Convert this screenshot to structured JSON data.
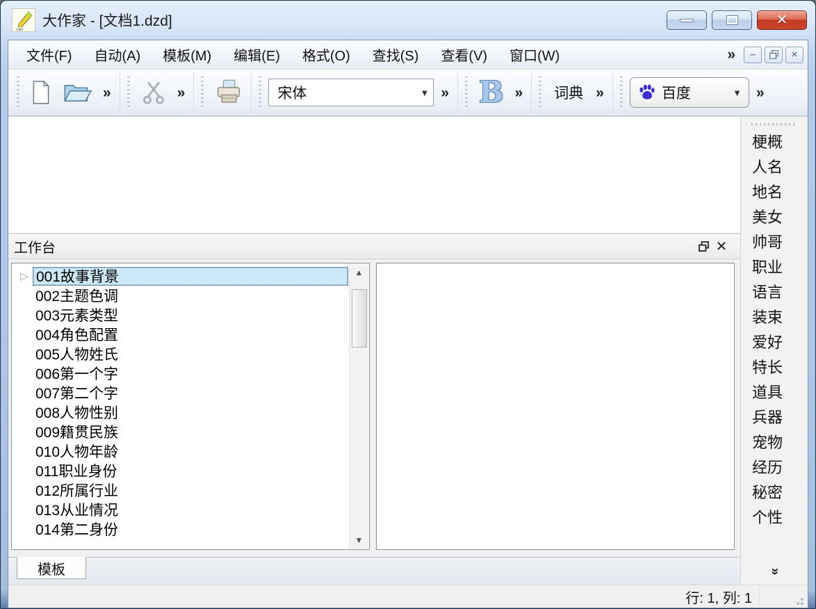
{
  "window": {
    "title": "大作家 - [文档1.dzd]"
  },
  "menubar": {
    "items": [
      "文件(F)",
      "自动(A)",
      "模板(M)",
      "编辑(E)",
      "格式(O)",
      "查找(S)",
      "查看(V)",
      "窗口(W)"
    ],
    "overflow": "»"
  },
  "toolbar": {
    "font_name": "宋体",
    "bold_label": "B",
    "dictionary_label": "词典",
    "search_engine_label": "百度",
    "overflow": "»",
    "dropdown_arrow": "▼"
  },
  "workbench": {
    "title": "工作台",
    "tree_items": [
      "001故事背景",
      "002主题色调",
      "003元素类型",
      "004角色配置",
      "005人物姓氏",
      "006第一个字",
      "007第二个字",
      "008人物性别",
      "009籍贯民族",
      "010人物年龄",
      "011职业身份",
      "012所属行业",
      "013从业情况",
      "014第二身份"
    ],
    "selected_item": "001故事背景",
    "expander_glyph": "▷",
    "scroll_up": "▲",
    "scroll_down": "▼"
  },
  "sidebar": {
    "items": [
      "梗概",
      "人名",
      "地名",
      "美女",
      "帅哥",
      "职业",
      "语言",
      "装束",
      "爱好",
      "特长",
      "道具",
      "兵器",
      "宠物",
      "经历",
      "秘密",
      "个性"
    ],
    "more_glyph": "»"
  },
  "bottom_tabs": {
    "template_label": "模板"
  },
  "statusbar": {
    "position": "行: 1,  列: 1"
  },
  "colors": {
    "titlebar_blue": "#b3c9e8",
    "close_red": "#c53821",
    "selection_blue": "#cde8f7",
    "baidu_blue": "#3c2fd4",
    "bold_blue": "#a8c6ea"
  }
}
